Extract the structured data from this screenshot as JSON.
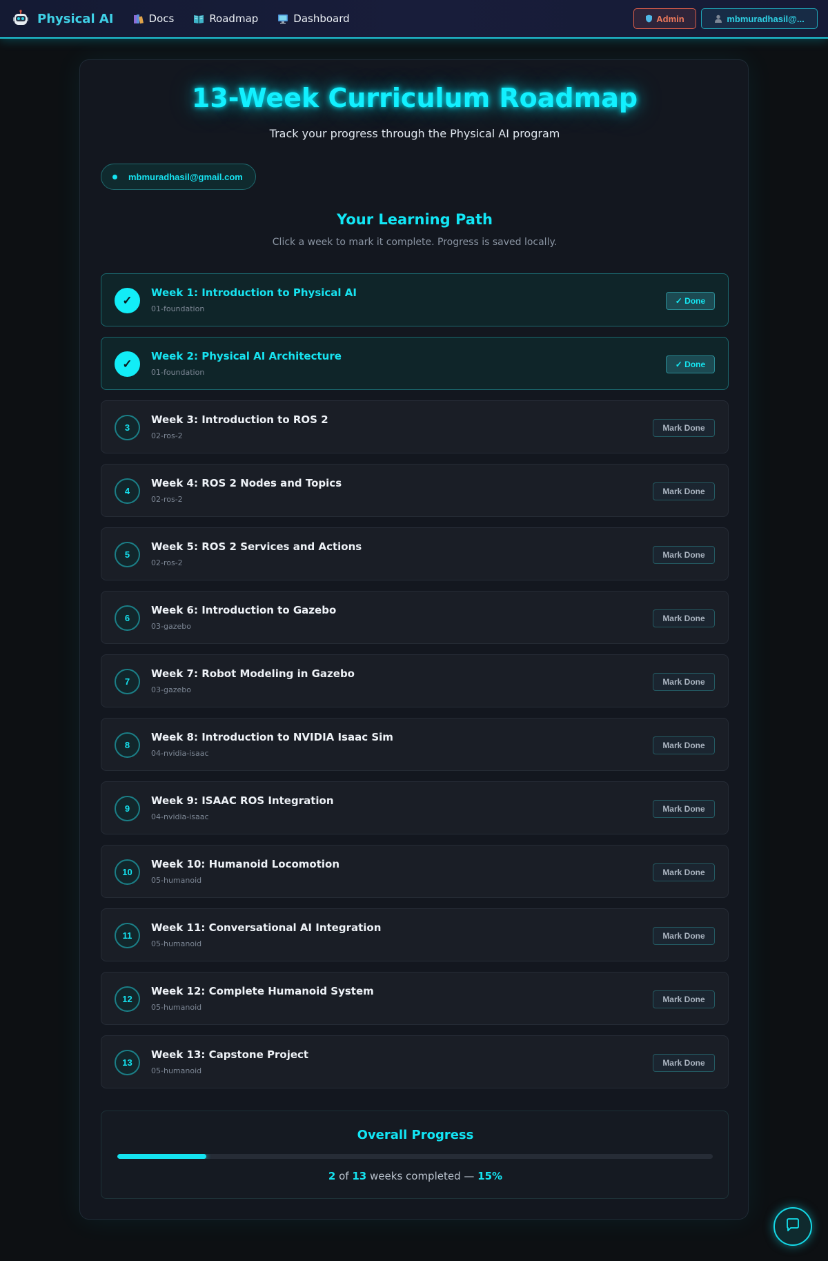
{
  "navbar": {
    "brand": "Physical AI",
    "links": [
      {
        "label": "Docs",
        "icon": "books-icon"
      },
      {
        "label": "Roadmap",
        "icon": "book-icon"
      },
      {
        "label": "Dashboard",
        "icon": "monitor-icon"
      }
    ],
    "admin_label": "Admin",
    "user_label": "mbmuradhasil@..."
  },
  "page": {
    "title": "13-Week Curriculum Roadmap",
    "subtitle": "Track your progress through the Physical AI program",
    "email": "mbmuradhasil@gmail.com",
    "path_title": "Your Learning Path",
    "path_subtitle": "Click a week to mark it complete. Progress is saved locally."
  },
  "weeks": [
    {
      "badge": "✓",
      "title": "Week 1: Introduction to Physical AI",
      "tag": "01-foundation",
      "done": true,
      "button": "✓ Done"
    },
    {
      "badge": "✓",
      "title": "Week 2: Physical AI Architecture",
      "tag": "01-foundation",
      "done": true,
      "button": "✓ Done"
    },
    {
      "badge": "3",
      "title": "Week 3: Introduction to ROS 2",
      "tag": "02-ros-2",
      "done": false,
      "button": "Mark Done"
    },
    {
      "badge": "4",
      "title": "Week 4: ROS 2 Nodes and Topics",
      "tag": "02-ros-2",
      "done": false,
      "button": "Mark Done"
    },
    {
      "badge": "5",
      "title": "Week 5: ROS 2 Services and Actions",
      "tag": "02-ros-2",
      "done": false,
      "button": "Mark Done"
    },
    {
      "badge": "6",
      "title": "Week 6: Introduction to Gazebo",
      "tag": "03-gazebo",
      "done": false,
      "button": "Mark Done"
    },
    {
      "badge": "7",
      "title": "Week 7: Robot Modeling in Gazebo",
      "tag": "03-gazebo",
      "done": false,
      "button": "Mark Done"
    },
    {
      "badge": "8",
      "title": "Week 8: Introduction to NVIDIA Isaac Sim",
      "tag": "04-nvidia-isaac",
      "done": false,
      "button": "Mark Done"
    },
    {
      "badge": "9",
      "title": "Week 9: ISAAC ROS Integration",
      "tag": "04-nvidia-isaac",
      "done": false,
      "button": "Mark Done"
    },
    {
      "badge": "10",
      "title": "Week 10: Humanoid Locomotion",
      "tag": "05-humanoid",
      "done": false,
      "button": "Mark Done"
    },
    {
      "badge": "11",
      "title": "Week 11: Conversational AI Integration",
      "tag": "05-humanoid",
      "done": false,
      "button": "Mark Done"
    },
    {
      "badge": "12",
      "title": "Week 12: Complete Humanoid System",
      "tag": "05-humanoid",
      "done": false,
      "button": "Mark Done"
    },
    {
      "badge": "13",
      "title": "Week 13: Capstone Project",
      "tag": "05-humanoid",
      "done": false,
      "button": "Mark Done"
    }
  ],
  "progress": {
    "title": "Overall Progress",
    "completed": "2",
    "of_word": "of",
    "total": "13",
    "suffix": "weeks completed —",
    "percent_label": "15%",
    "fraction": 0.15
  },
  "colors": {
    "accent": "#14e3f0",
    "admin": "#f07a5c",
    "background": "#0d1013"
  }
}
